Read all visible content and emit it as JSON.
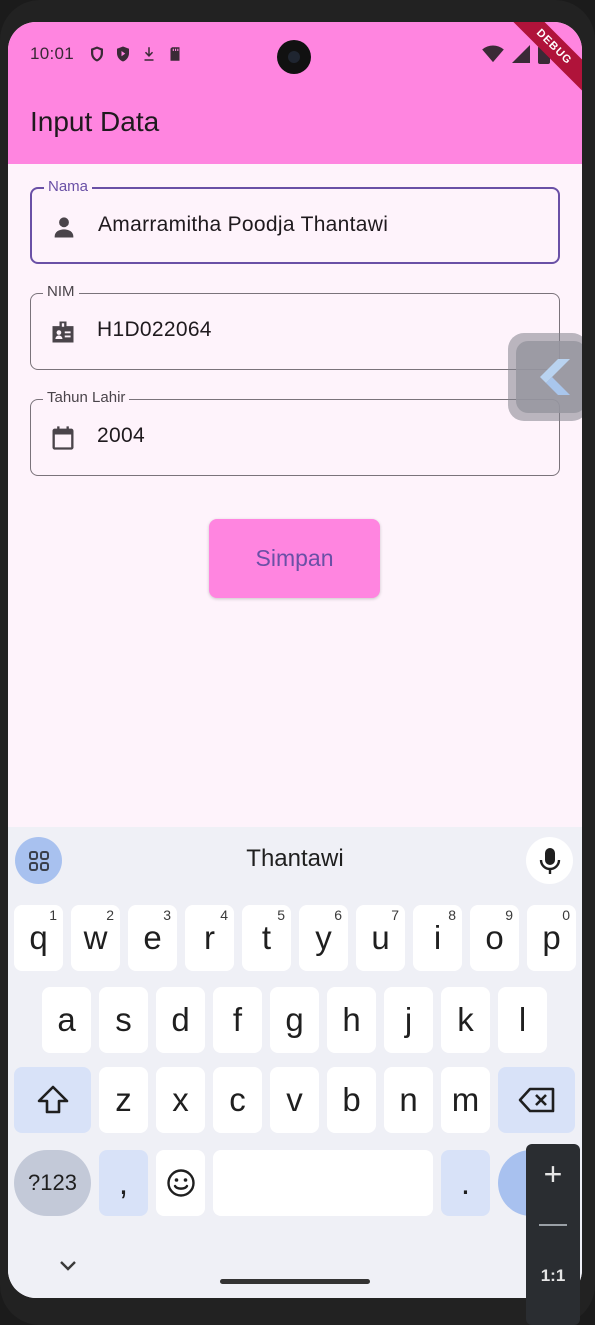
{
  "status_bar": {
    "time": "10:01",
    "left_icons": [
      "shield-outline-icon",
      "shield-play-icon",
      "download-icon",
      "sd-card-icon"
    ],
    "right_icons": [
      "wifi-icon",
      "signal-icon",
      "battery-icon"
    ]
  },
  "debug_banner": "DEBUG",
  "app_bar": {
    "title": "Input Data",
    "color": "#ff85e0"
  },
  "form": {
    "nama": {
      "label": "Nama",
      "value": "Amarramitha Poodja Thantawi",
      "icon": "person-icon"
    },
    "nim": {
      "label": "NIM",
      "value": "H1D022064",
      "icon": "badge-icon"
    },
    "tahun_lahir": {
      "label": "Tahun Lahir",
      "value": "2004",
      "icon": "calendar-icon"
    },
    "save_label": "Simpan"
  },
  "keyboard": {
    "suggestion": "Thantawi",
    "row1": [
      {
        "k": "q",
        "h": "1"
      },
      {
        "k": "w",
        "h": "2"
      },
      {
        "k": "e",
        "h": "3"
      },
      {
        "k": "r",
        "h": "4"
      },
      {
        "k": "t",
        "h": "5"
      },
      {
        "k": "y",
        "h": "6"
      },
      {
        "k": "u",
        "h": "7"
      },
      {
        "k": "i",
        "h": "8"
      },
      {
        "k": "o",
        "h": "9"
      },
      {
        "k": "p",
        "h": "0"
      }
    ],
    "row2": [
      "a",
      "s",
      "d",
      "f",
      "g",
      "h",
      "j",
      "k",
      "l"
    ],
    "row3": [
      "z",
      "x",
      "c",
      "v",
      "b",
      "n",
      "m"
    ],
    "symbols_label": "?123",
    "comma": ",",
    "period": "."
  },
  "zoom_controls": {
    "plus": "+",
    "fit": "1:1"
  }
}
